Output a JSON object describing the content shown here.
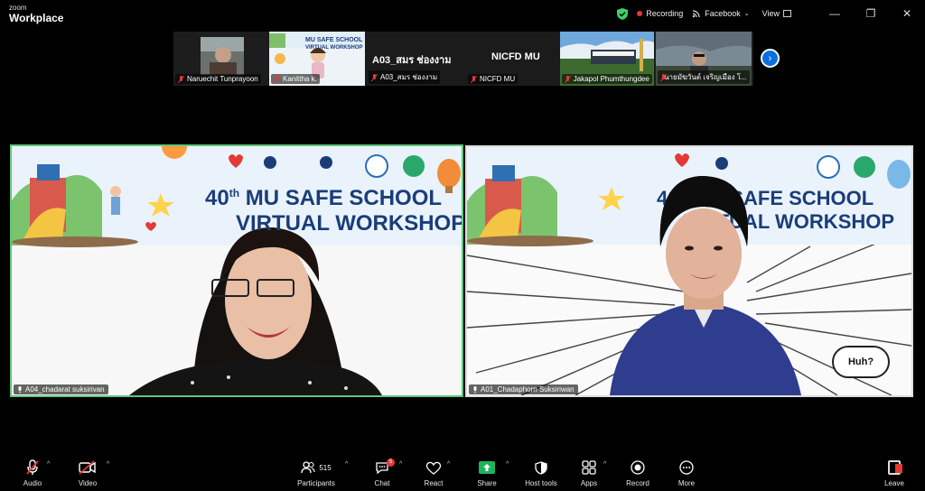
{
  "app": {
    "brand_small": "zoom",
    "brand_main": "Workplace"
  },
  "status": {
    "recording_label": "Recording",
    "stream_label": "Facebook",
    "view_label": "View",
    "colors": {
      "recording": "#e53935",
      "shield": "#3ad36a"
    }
  },
  "window_controls": {
    "minimize": "—",
    "restore": "❐",
    "close": "✕"
  },
  "gallery": {
    "participants": [
      {
        "name": "Naruechit Tunprayoon"
      },
      {
        "name": "Kanittha k."
      },
      {
        "name": "A03_สมร ช่องงาม",
        "overlay_text": "A03_สมร ช่องงาม"
      },
      {
        "name": "NICFD MU",
        "overlay_text": "NICFD MU"
      },
      {
        "name": "Jakapol Phumthungdee"
      },
      {
        "name": "นายมัฆวันต์ เจริญเมือง โ..."
      }
    ],
    "next_icon": "›"
  },
  "banner": {
    "title_line1": "40",
    "title_sup": "th",
    "title_line1_rest": " MU SAFE SCHOOL",
    "title_line2": "VIRTUAL WORKSHOP",
    "strip_title": "MU SAFE SCHOOL",
    "strip_sub": "VIRTUAL WORKSHOP"
  },
  "videos": [
    {
      "name": "A04_chadarat suksirivan"
    },
    {
      "name": "A01_Chadaphorn Suksiriwan",
      "speech_bubble": "Huh?"
    }
  ],
  "toolbar": {
    "audio": "Audio",
    "video": "Video",
    "participants": "Participants",
    "participant_count": "515",
    "chat": "Chat",
    "chat_badge": "5",
    "react": "React",
    "share": "Share",
    "host_tools": "Host tools",
    "apps": "Apps",
    "record": "Record",
    "more": "More",
    "leave": "Leave"
  }
}
